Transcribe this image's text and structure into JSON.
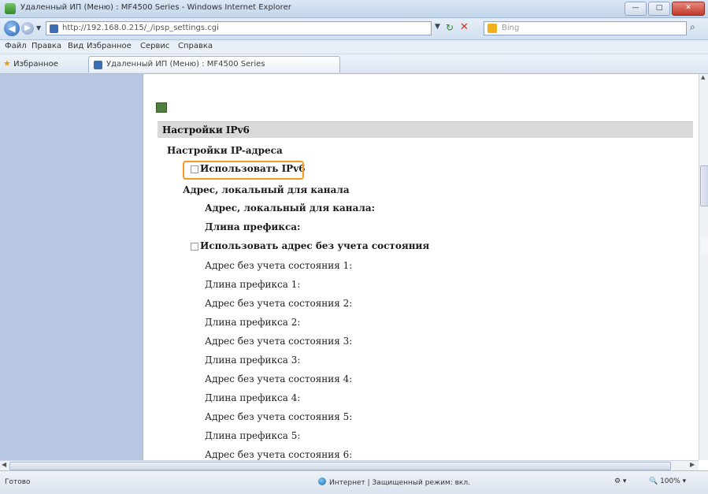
{
  "window": {
    "title": "Удаленный ИП (Меню) : MF4500 Series - Windows Internet Explorer",
    "buttons": {
      "minimize": "—",
      "maximize": "□",
      "close": "✕"
    }
  },
  "navbar": {
    "back": "◀",
    "forward": "▶",
    "address": "http://192.168.0.215/_/ipsp_settings.cgi",
    "search_placeholder": "Bing",
    "refresh": "↻",
    "stop": "✕"
  },
  "menubar": {
    "items": [
      "Файл",
      "Правка",
      "Вид",
      "Избранное",
      "Сервис",
      "Справка"
    ]
  },
  "favbar": {
    "favorites_label": "Избранное",
    "tab_label": "Удаленный ИП (Меню) : MF4500 Series"
  },
  "page": {
    "section_title": "Настройки IPv6",
    "ip_settings": "Настройки IP-адреса",
    "use_ipv6": "Использовать IPv6",
    "link_local_group": "Адрес, локальный для канала",
    "link_local_address": "Адрес, локальный для канала:",
    "prefix_length": "Длина префикса:",
    "use_stateless": "Использовать адрес без учета состояния",
    "rows": [
      "Адрес без учета состояния 1:",
      "Длина префикса 1:",
      "Адрес без учета состояния 2:",
      "Длина префикса 2:",
      "Адрес без учета состояния 3:",
      "Длина префикса 3:",
      "Адрес без учета состояния 4:",
      "Длина префикса 4:",
      "Адрес без учета состояния 5:",
      "Длина префикса 5:",
      "Адрес без учета состояния 6:"
    ]
  },
  "statusbar": {
    "status": "Готово",
    "zone": "Интернет | Защищенный режим: вкл.",
    "zoom": "100%"
  },
  "colors": {
    "left_nav": "#b9c6e1",
    "highlight": "#f29b1f",
    "section_bg": "#d9d9d9"
  }
}
